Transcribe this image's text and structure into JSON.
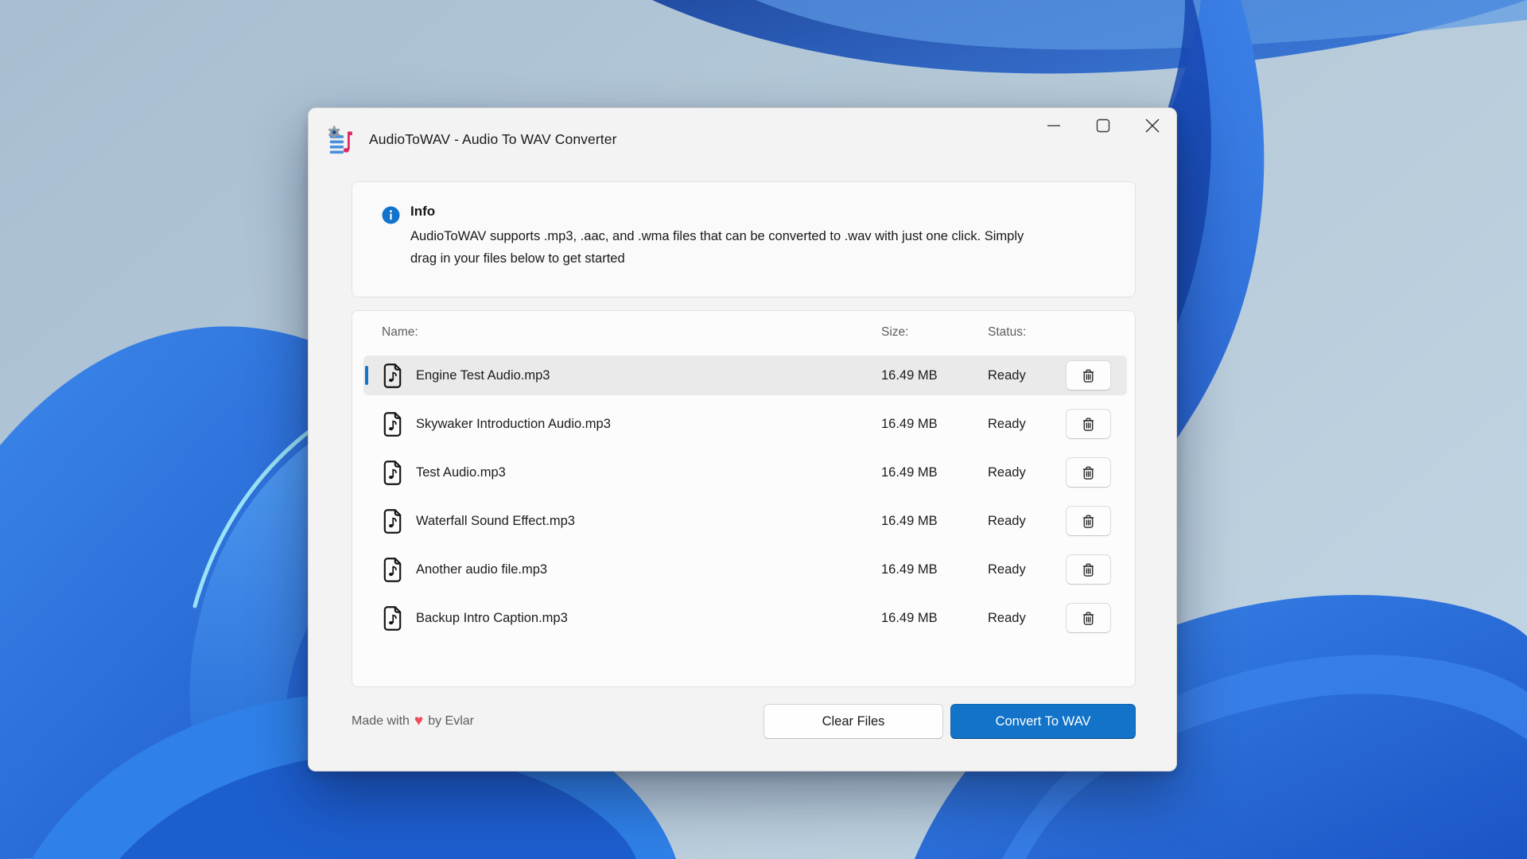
{
  "window": {
    "title": "AudioToWAV - Audio To WAV Converter"
  },
  "info_panel": {
    "heading": "Info",
    "description": "AudioToWAV supports .mp3, .aac, and .wma files that can be converted to .wav with just one click. Simply drag in your files below to get started"
  },
  "file_list": {
    "header": {
      "name": "Name:",
      "size": "Size:",
      "status": "Status:"
    },
    "rows": [
      {
        "name": "Engine Test Audio.mp3",
        "size": "16.49 MB",
        "status": "Ready",
        "selected": true
      },
      {
        "name": "Skywaker Introduction Audio.mp3",
        "size": "16.49 MB",
        "status": "Ready",
        "selected": false
      },
      {
        "name": "Test Audio.mp3",
        "size": "16.49 MB",
        "status": "Ready",
        "selected": false
      },
      {
        "name": "Waterfall Sound Effect.mp3",
        "size": "16.49 MB",
        "status": "Ready",
        "selected": false
      },
      {
        "name": "Another audio file.mp3",
        "size": "16.49 MB",
        "status": "Ready",
        "selected": false
      },
      {
        "name": "Backup Intro Caption.mp3",
        "size": "16.49 MB",
        "status": "Ready",
        "selected": false
      }
    ]
  },
  "footer": {
    "credit_prefix": "Made with",
    "heart": "♥",
    "credit_suffix": "by Evlar",
    "clear_files_label": "Clear Files",
    "convert_label": "Convert To WAV"
  },
  "colors": {
    "accent_blue": "#1273c8",
    "heart_red": "#ee4c5c",
    "app_icon_pink": "#e02766",
    "app_icon_line_blue": "#4a8fdb",
    "selected_row_bg": "#eaeaeb"
  }
}
